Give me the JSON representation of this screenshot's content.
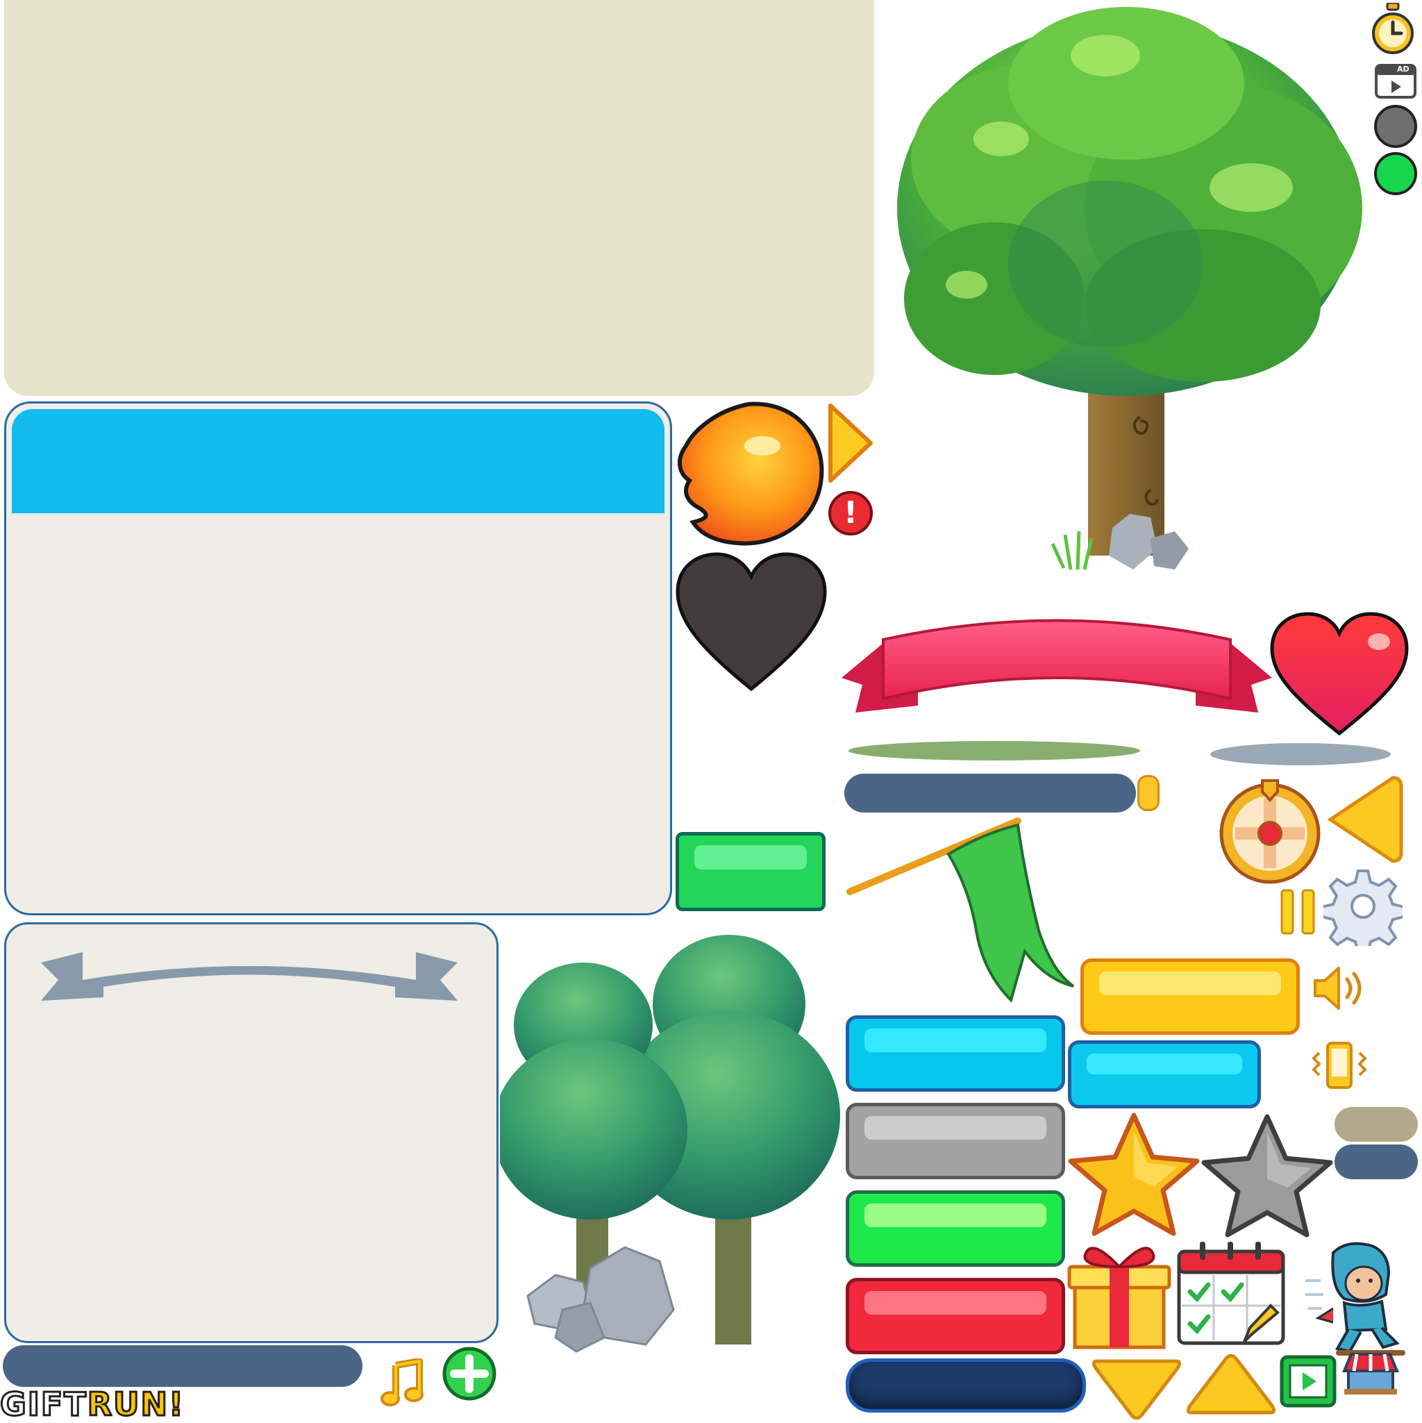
{
  "title": "",
  "logo": {
    "part1": "GIFT",
    "part2": "RUN!"
  },
  "icons": {
    "stopwatch": "stopwatch-icon",
    "ad_video": "ad-video-icon",
    "ad_label": "AD",
    "dot_gray": "gray-dot-icon",
    "dot_green": "green-dot-icon",
    "fireball": "fireball-icon",
    "arrow_right": "play-arrow-icon",
    "alert": "alert-icon",
    "alert_mark": "!",
    "heart_dark": "empty-heart-icon",
    "heart_red": "heart-icon",
    "ribbon": "ribbon-banner",
    "wheel": "lucky-wheel-icon",
    "arrow_left": "back-arrow-icon",
    "pause": "pause-icon",
    "gear": "gear-icon",
    "sound": "sound-icon",
    "vibrate": "vibrate-icon",
    "star_gold": "star-gold-icon",
    "star_gray": "star-gray-icon",
    "gift": "gift-icon",
    "calendar": "calendar-icon",
    "arrow_down": "down-arrow-icon",
    "arrow_up": "up-arrow-icon",
    "video": "video-play-icon",
    "shop": "shop-icon",
    "music": "music-icon",
    "plus": "plus-icon",
    "flag": "flag-icon",
    "character": "dino-kid-character"
  },
  "colors": {
    "panel_beige": "#e8e3cb",
    "panel_header_blue": "#12bbee",
    "panel_body": "#efede6",
    "panel_border": "#2a6aa0",
    "bar_navy": "#4a6585",
    "button_yellow": "#fdcb17",
    "button_cyan": "#08c7ee",
    "button_gray": "#a3a3a3",
    "button_green": "#1ee94a",
    "button_red": "#f1293d",
    "button_navy": "#1e3a6a",
    "tree_green": "#3e9a3a",
    "heart_red": "#f0293f"
  }
}
